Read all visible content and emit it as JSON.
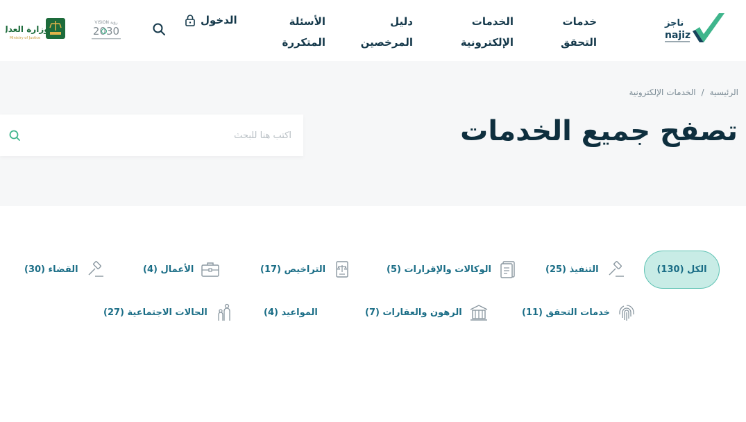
{
  "header": {
    "logo_text": "ناجز",
    "logo_latin": "najiz",
    "nav": [
      {
        "line1": "خدمات",
        "line2": "التحقق"
      },
      {
        "line1": "الخدمات",
        "line2": "الإلكترونية"
      },
      {
        "line1": "دليل",
        "line2": "المرخصين"
      },
      {
        "line1": "الأسئلة",
        "line2": "المتكررة"
      }
    ],
    "login_label": "الدخول",
    "vision_top": "VISION رؤية",
    "vision_year": "2030",
    "moj_ar": "وزارة العدل",
    "moj_en": "Ministry of Justice"
  },
  "breadcrumb": {
    "home": "الرئيسية",
    "separator": "/",
    "current": "الخدمات الإلكترونية"
  },
  "page_title": "تصفح جميع الخدمات",
  "search": {
    "placeholder": "اكتب هنا للبحث"
  },
  "filters": {
    "all": "الكل (130)",
    "row1": [
      {
        "label": "التنفيذ (25)",
        "icon": "gavel-icon"
      },
      {
        "label": "الوكالات والإقرارات (5)",
        "icon": "document-icon"
      },
      {
        "label": "التراخيص (17)",
        "icon": "license-icon"
      },
      {
        "label": "الأعمال (4)",
        "icon": "briefcase-icon"
      },
      {
        "label": "القضاء (30)",
        "icon": "gavel-icon"
      }
    ],
    "row2": [
      {
        "label": "خدمات التحقق (11)",
        "icon": "fingerprint-icon"
      },
      {
        "label": "الرهون والعقارات (7)",
        "icon": "building-icon"
      },
      {
        "label": "المواعيد (4)",
        "icon": ""
      },
      {
        "label": "الحالات الاجتماعية (27)",
        "icon": "family-icon"
      }
    ]
  },
  "colors": {
    "brand_green": "#3fb58c",
    "brand_navy": "#14384a",
    "filter_text": "#1a6d86",
    "active_bg": "#c8ece6"
  }
}
